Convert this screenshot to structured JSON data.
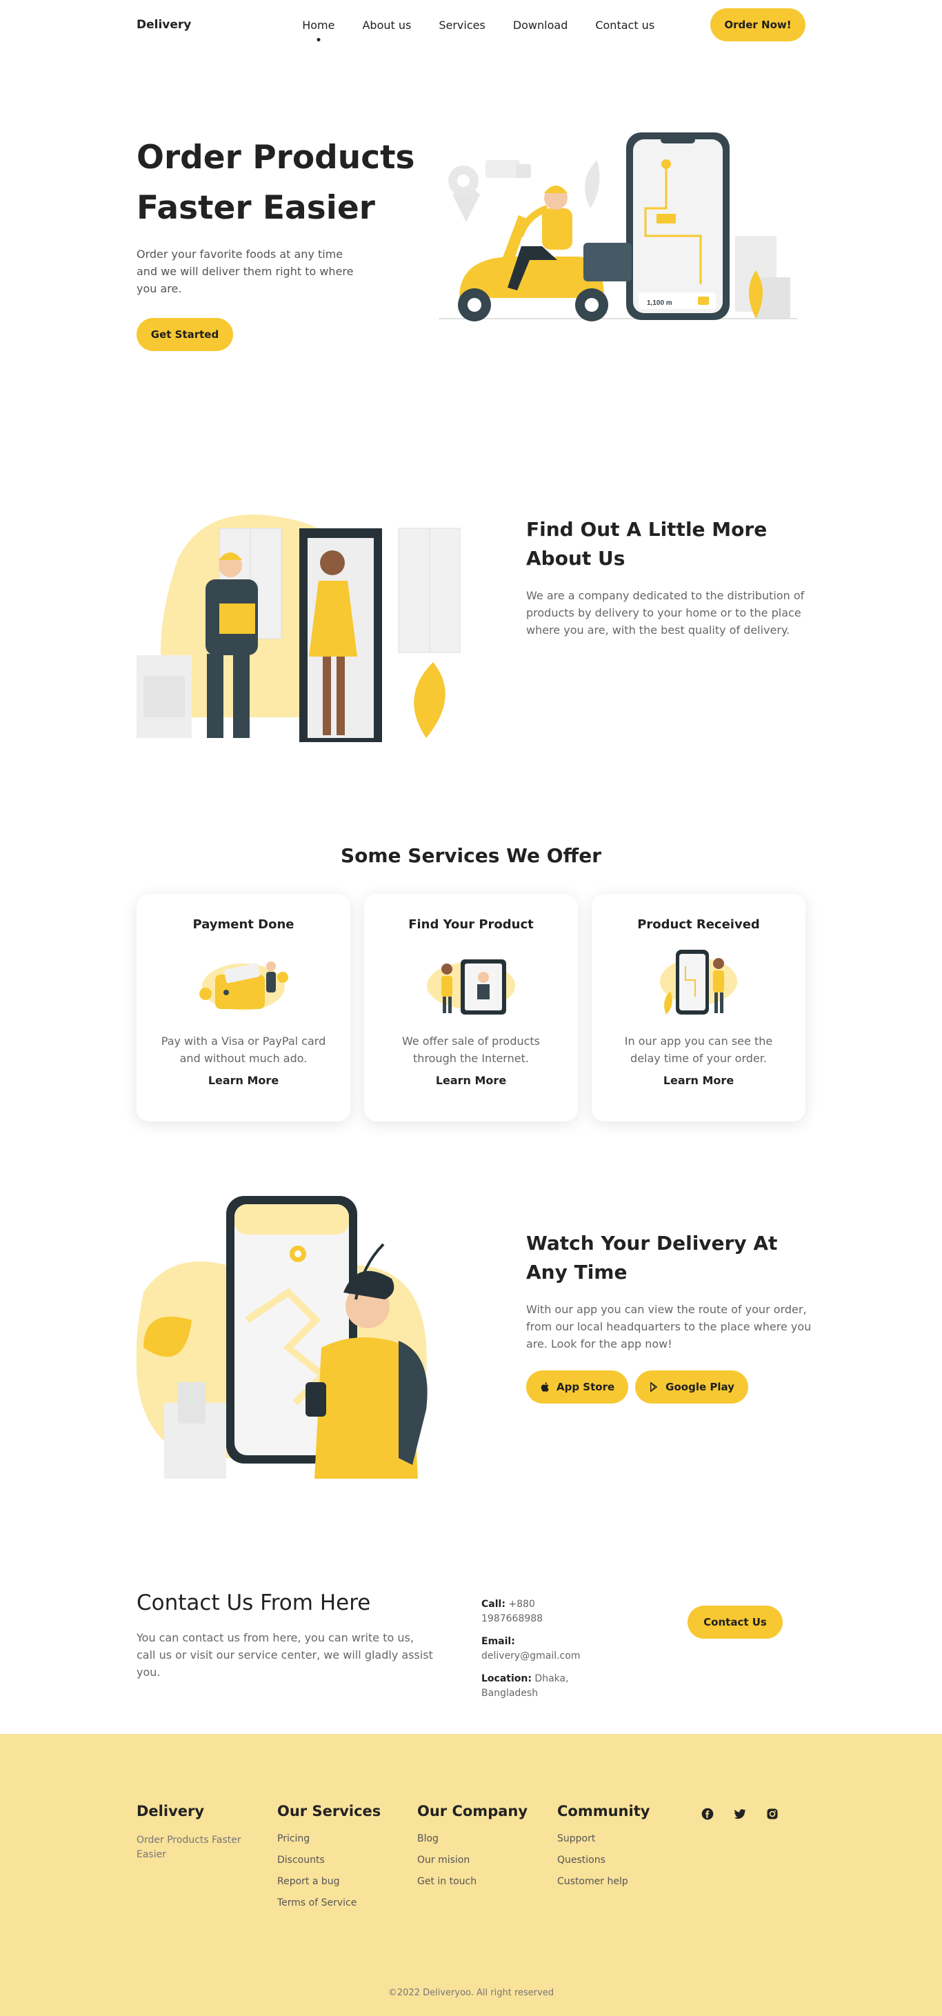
{
  "header": {
    "logo": "Delivery",
    "nav": [
      "Home",
      "About us",
      "Services",
      "Download",
      "Contact us"
    ],
    "active_nav": "Home",
    "order_button": "Order Now!"
  },
  "hero": {
    "title_line1": "Order Products",
    "title_line2": "Faster Easier",
    "description": "Order your favorite foods at any time and we will deliver them right to where you are.",
    "cta": "Get Started",
    "illustration": {
      "scooter_distance": "1,100 m"
    }
  },
  "about": {
    "title": "Find Out A Little More About Us",
    "description": "We are a company dedicated to the distribution of products by delivery to your home or to the place where you are, with the best quality of delivery."
  },
  "services": {
    "title": "Some Services We Offer",
    "cards": [
      {
        "title": "Payment Done",
        "description": "Pay with a Visa or PayPal card and without much ado.",
        "link": "Learn More"
      },
      {
        "title": "Find Your Product",
        "description": "We offer sale of products through the Internet.",
        "link": "Learn More"
      },
      {
        "title": "Product Received",
        "description": "In our app you can see the delay time of your order.",
        "link": "Learn More"
      }
    ]
  },
  "watch": {
    "title": "Watch Your Delivery At Any Time",
    "description": "With our app you can view the route of your order, from our local headquarters to the place where you are. Look for the app now!",
    "app_store": "App Store",
    "google_play": "Google Play"
  },
  "contact": {
    "title": "Contact Us From Here",
    "description": "You can contact us from here, you can write to us, call us or visit our service center, we will gladly assist you.",
    "call_label": "Call:",
    "call_value": "+880 1987668988",
    "email_label": "Email:",
    "email_value": "delivery@gmail.com",
    "location_label": "Location:",
    "location_value": "Dhaka, Bangladesh",
    "button": "Contact Us"
  },
  "footer": {
    "brand": "Delivery",
    "brand_sub": "Order Products Faster Easier",
    "columns": [
      {
        "title": "Our Services",
        "links": [
          "Pricing",
          "Discounts",
          "Report a bug",
          "Terms of Service"
        ]
      },
      {
        "title": "Our Company",
        "links": [
          "Blog",
          "Our mision",
          "Get in touch"
        ]
      },
      {
        "title": "Community",
        "links": [
          "Support",
          "Questions",
          "Customer help"
        ]
      }
    ],
    "socials": [
      "facebook-icon",
      "twitter-icon",
      "instagram-icon"
    ],
    "copyright": "©2022 Deliveryoo. All right reserved"
  },
  "colors": {
    "accent": "#f7c831",
    "footer_bg": "#f9e29a",
    "dark": "#37474f"
  }
}
